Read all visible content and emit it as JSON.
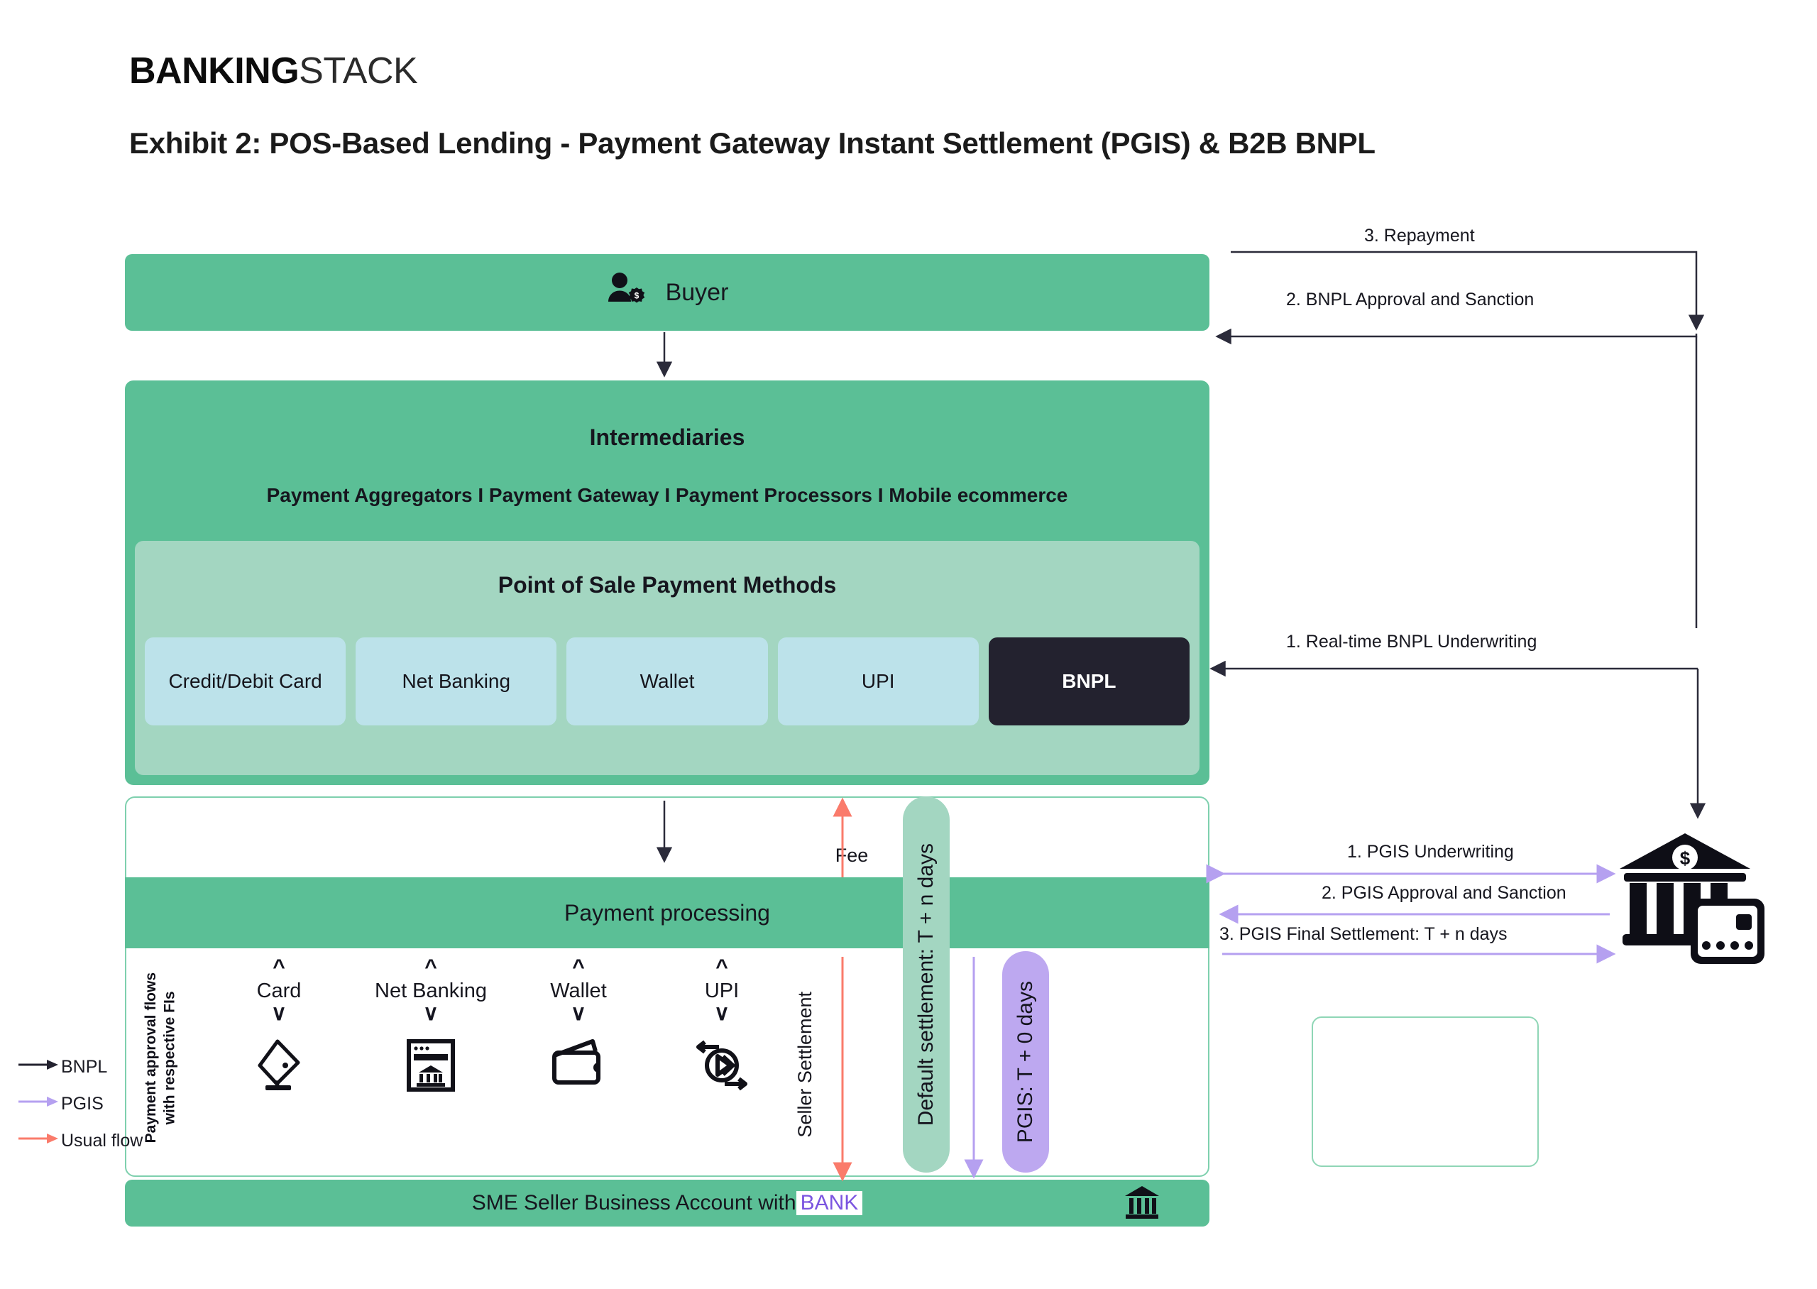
{
  "brand": {
    "bold": "BANKING",
    "light": "STACK"
  },
  "header": {
    "title": "Exhibit 2: POS-Based Lending - Payment Gateway Instant Settlement (PGIS) & B2B BNPL"
  },
  "buyer": {
    "label": "Buyer",
    "icon": "buyer-person-dollar-icon"
  },
  "intermediaries": {
    "title": "Intermediaries",
    "subtitle": "Payment Aggregators I Payment Gateway I Payment Processors I Mobile ecommerce"
  },
  "pos": {
    "title": "Point of Sale Payment Methods",
    "methods": [
      {
        "label": "Credit/Debit Card",
        "active": false
      },
      {
        "label": "Net Banking",
        "active": false
      },
      {
        "label": "Wallet",
        "active": false
      },
      {
        "label": "UPI",
        "active": false
      },
      {
        "label": "BNPL",
        "active": true
      }
    ]
  },
  "payment_processing": {
    "label": "Payment processing"
  },
  "approval_flows": {
    "label": "Payment approval flows\nwith respective FIs"
  },
  "payment_icons": [
    {
      "label": "Card",
      "icon": "card-swipe-icon"
    },
    {
      "label": "Net Banking",
      "icon": "net-banking-browser-bank-icon"
    },
    {
      "label": "Wallet",
      "icon": "wallet-icon"
    },
    {
      "label": "UPI",
      "icon": "upi-transfer-icon"
    }
  ],
  "flows": {
    "fee": "Fee",
    "seller_settlement": "Seller Settlement",
    "default_settlement": "Default settlement: T + n days",
    "pgis_settlement": "PGIS: T + 0 days"
  },
  "sme": {
    "prefix": "SME Seller Business Account with",
    "bank": "BANK",
    "icon": "bank-building-icon"
  },
  "bnpl_annotations": [
    "3. Repayment",
    "2. BNPL Approval and Sanction",
    "1. Real-time BNPL Underwriting"
  ],
  "pgis_annotations": [
    "1. PGIS Underwriting",
    "2. PGIS Approval and Sanction",
    "3. PGIS Final Settlement: T + n days"
  ],
  "bank_right": {
    "icon": "bank-with-card-icon"
  },
  "legend": {
    "items": [
      {
        "label": "BNPL",
        "color": "#23222f"
      },
      {
        "label": "PGIS",
        "color": "#b5a0f0"
      },
      {
        "label": "Usual flow",
        "color": "#fa7b6b"
      }
    ]
  },
  "colors": {
    "green": "#5bbf96",
    "green_light": "#a3d6c1",
    "blue_light": "#bce2ea",
    "dark": "#23222f",
    "purple": "#bda8f0",
    "red": "#fa7b6b"
  }
}
